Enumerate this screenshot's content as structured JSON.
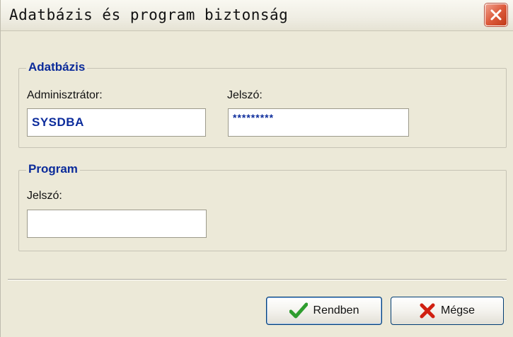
{
  "window": {
    "title": "Adatbázis és program biztonság",
    "close_icon": "close-icon"
  },
  "database_group": {
    "title": "Adatbázis",
    "admin_label": "Adminisztrátor:",
    "admin_value": "SYSDBA",
    "password_label": "Jelszó:",
    "password_value": "*********"
  },
  "program_group": {
    "title": "Program",
    "password_label": "Jelszó:",
    "password_value": ""
  },
  "buttons": {
    "ok_label": "Rendben",
    "ok_icon": "checkmark-icon",
    "cancel_label": "Mégse",
    "cancel_icon": "x-icon"
  },
  "colors": {
    "accent_text": "#0b2b9a",
    "ok_check": "#2e9d2e",
    "cancel_x": "#d01f10",
    "close_button": "#dd5b3c"
  }
}
